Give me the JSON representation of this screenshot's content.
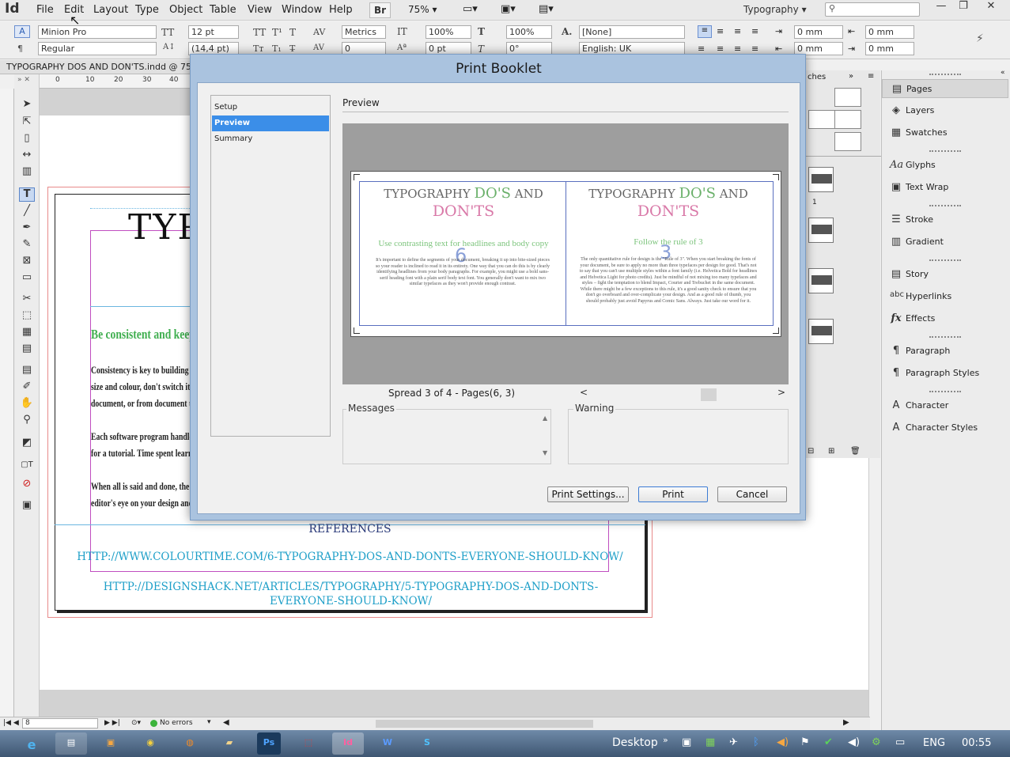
{
  "app": {
    "logo": "Id"
  },
  "menu": [
    "File",
    "Edit",
    "Layout",
    "Type",
    "Object",
    "Table",
    "View",
    "Window",
    "Help"
  ],
  "menubar": {
    "bridge_label": "Br",
    "zoom": "75%",
    "workspace": "Typography"
  },
  "controlbar": {
    "font_family": "Minion Pro",
    "font_style": "Regular",
    "font_size": "12 pt",
    "leading": "(14,4 pt)",
    "kerning": "Metrics",
    "tracking": "0",
    "v_scale": "100%",
    "h_scale": "100%",
    "baseline_shift": "0 pt",
    "skew": "0°",
    "char_style": "[None]",
    "language": "English: UK",
    "indent_left": "0 mm",
    "indent_right": "0 mm",
    "indent_first": "0 mm",
    "indent_last": "0 mm"
  },
  "document": {
    "tab_title": "TYPOGRAPHY DOS AND DON'TS.indd @ 75%",
    "ruler_ticks": [
      "0",
      "10",
      "20",
      "30",
      "40"
    ],
    "page_title_fragment": "TYP",
    "heading_fragment": "Be consistent and keep i",
    "lines": [
      "Consistency is key to building a",
      "size and colour, don't switch it",
      "document, or from document t",
      "Each software program handle",
      "for a tutorial. Time spent learn",
      "When all is said and done, the i",
      "editor's eye on your design and"
    ],
    "references_title": "REFERENCES",
    "ref1": "HTTP://WWW.COLOURTIME.COM/6-TYPOGRAPHY-DOS-AND-DONTS-EVERYONE-SHOULD-KNOW/",
    "ref2": "HTTP://DESIGNSHACK.NET/ARTICLES/TYPOGRAPHY/5-TYPOGRAPHY-DOS-AND-DONTS-EVERYONE-SHOULD-KNOW/"
  },
  "status": {
    "page": "8",
    "errors": "No errors"
  },
  "dialog": {
    "title": "Print Booklet",
    "nav": [
      "Setup",
      "Preview",
      "Summary"
    ],
    "preview_label": "Preview",
    "spread": {
      "left": {
        "title_a": "TYPOGRAPHY ",
        "title_b": "DO'S",
        "title_c": " AND",
        "title_d": "DON'TS",
        "heading": "Use contrasting text for headlines and body copy",
        "body": "It's important to define the segments of your document, breaking it up into bite-sized pieces so your reader is inclined to read it in its entirety. One way that you can do this is by clearly identifying headlines from your body paragraphs. For example, you might use a bold sans-serif heading font with a plain serif body text font. You generally don't want to mix two similar typefaces as they won't provide enough contrast.",
        "number": "6"
      },
      "right": {
        "title_a": "TYPOGRAPHY ",
        "title_b": "DO'S",
        "title_c": " AND",
        "title_d": "DON'TS",
        "heading": "Follow the rule of 3",
        "body": "The only quantitative rule for design is the \"Rule of 3\". When you start breaking the fonts of your document, be sure to apply no more than three typefaces per design for good. That's not to say that you can't use multiple styles within a font family (i.e. Helvetica Bold for headlines and Helvetica Light for photo credits). Just be mindful of not mixing too many typefaces and styles – fight the temptation to blend Impact, Courier and Trebuchet in the same document. While there might be a few exceptions to this rule, it's a good sanity check to ensure that you don't go overboard and over-complicate your design. And as a good rule of thumb, you should probably just avoid Papyrus and Comic Sans. Always. Just take our word for it.",
        "number": "3"
      }
    },
    "spread_status": "Spread 3 of 4 - Pages(6, 3)",
    "messages_label": "Messages",
    "warning_label": "Warning",
    "buttons": {
      "print_settings": "Print Settings...",
      "print": "Print",
      "cancel": "Cancel"
    }
  },
  "panels": {
    "middle_header": "ches",
    "page_number": "1",
    "items": [
      {
        "label": "Pages",
        "icon": "pages-icon"
      },
      {
        "label": "Layers",
        "icon": "layers-icon"
      },
      {
        "label": "Swatches",
        "icon": "swatches-icon"
      },
      {
        "label": "Glyphs",
        "icon": "glyphs-icon"
      },
      {
        "label": "Text Wrap",
        "icon": "text-wrap-icon"
      },
      {
        "label": "Stroke",
        "icon": "stroke-icon"
      },
      {
        "label": "Gradient",
        "icon": "gradient-icon"
      },
      {
        "label": "Story",
        "icon": "story-icon"
      },
      {
        "label": "Hyperlinks",
        "icon": "hyperlinks-icon"
      },
      {
        "label": "Effects",
        "icon": "effects-icon"
      },
      {
        "label": "Paragraph",
        "icon": "paragraph-icon"
      },
      {
        "label": "Paragraph Styles",
        "icon": "paragraph-styles-icon"
      },
      {
        "label": "Character",
        "icon": "character-icon"
      },
      {
        "label": "Character Styles",
        "icon": "character-styles-icon"
      }
    ]
  },
  "taskbar": {
    "desktop": "Desktop",
    "lang": "ENG",
    "time": "00:55"
  },
  "colors": {
    "selection": "#3b8ee8",
    "green": "#6ab06a",
    "pink": "#d979a8",
    "link": "#1e9fc8"
  }
}
